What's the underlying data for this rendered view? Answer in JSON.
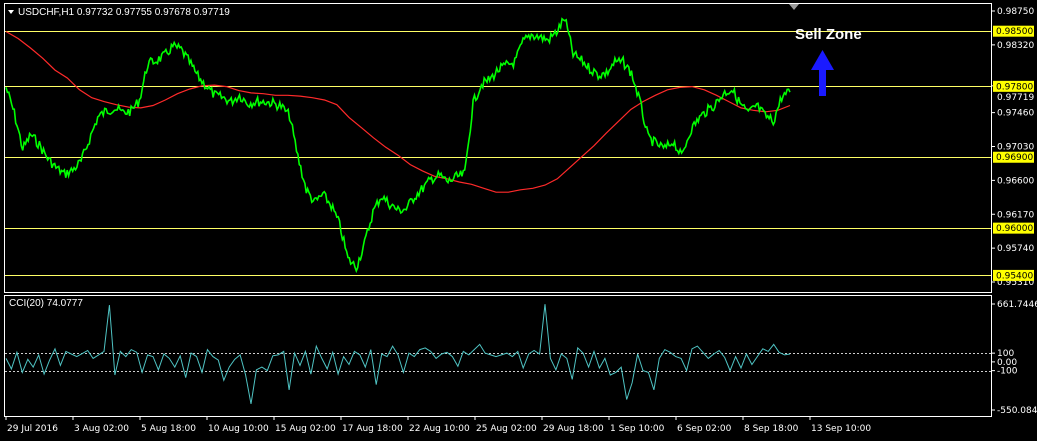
{
  "header": {
    "symbol_text": "USDCHF,H1  0.97732 0.97755 0.97678 0.97719",
    "indicator_text": "CCI(20) 74.0777"
  },
  "annotation": {
    "text": "Sell Zone",
    "arrow_color": "#1a1aff"
  },
  "colors": {
    "background": "#000000",
    "price_line": "#00ff00",
    "moving_average": "#ff2a2a",
    "level_line": "#ffff66",
    "level_label_bg": "#ffff00",
    "cci_line": "#4fc3c3",
    "axis_text": "#ffffff"
  },
  "chart_data": [
    {
      "type": "line",
      "title": "USDCHF,H1",
      "ylim": [
        0.9531,
        0.9875
      ],
      "x_ticks": [
        "29 Jul 2016",
        "3 Aug 02:00",
        "5 Aug 18:00",
        "10 Aug 10:00",
        "15 Aug 02:00",
        "17 Aug 18:00",
        "22 Aug 10:00",
        "25 Aug 02:00",
        "29 Aug 18:00",
        "1 Sep 10:00",
        "6 Sep 02:00",
        "8 Sep 18:00",
        "13 Sep 10:00"
      ],
      "y_ticks": [
        "0.98750",
        "0.98320",
        "0.97800",
        "0.97460",
        "0.97030",
        "0.96600",
        "0.96170",
        "0.95740",
        "0.95310"
      ],
      "level_lines": [
        0.985,
        0.978,
        0.969,
        0.96,
        0.954
      ],
      "level_labels": [
        "0.98500",
        "0.97800",
        "0.96900",
        "0.96000",
        "0.95400"
      ],
      "current_price": 0.97719,
      "current_label": "0.97719",
      "series": [
        {
          "values": [
            0.9778,
            0.9745,
            0.97,
            0.9718,
            0.9705,
            0.9688,
            0.9676,
            0.9668,
            0.9673,
            0.9684,
            0.9712,
            0.974,
            0.9748,
            0.9752,
            0.9746,
            0.9748,
            0.9762,
            0.9808,
            0.9812,
            0.9818,
            0.983,
            0.9826,
            0.981,
            0.9792,
            0.978,
            0.9768,
            0.9765,
            0.976,
            0.9768,
            0.9758,
            0.976,
            0.976,
            0.9758,
            0.9754,
            0.9742,
            0.969,
            0.9648,
            0.9632,
            0.9642,
            0.9628,
            0.9604,
            0.956,
            0.955,
            0.958,
            0.962,
            0.964,
            0.963,
            0.9622,
            0.9624,
            0.964,
            0.965,
            0.9662,
            0.9666,
            0.9658,
            0.9664,
            0.9668,
            0.9758,
            0.9782,
            0.9788,
            0.98,
            0.9806,
            0.981,
            0.9836,
            0.9845,
            0.9842,
            0.9838,
            0.9848,
            0.9866,
            0.982,
            0.9812,
            0.9802,
            0.9794,
            0.9796,
            0.981,
            0.981,
            0.9796,
            0.976,
            0.9714,
            0.9706,
            0.97,
            0.971,
            0.969,
            0.9722,
            0.9738,
            0.9748,
            0.9756,
            0.977,
            0.9776,
            0.9758,
            0.9745,
            0.9755,
            0.9742,
            0.9735,
            0.9766,
            0.9772
          ]
        },
        {
          "values": [
            0.9849,
            0.984,
            0.9828,
            0.9815,
            0.98,
            0.979,
            0.9775,
            0.9765,
            0.976,
            0.9756,
            0.9753,
            0.9752,
            0.9755,
            0.9762,
            0.977,
            0.9776,
            0.978,
            0.9781,
            0.9779,
            0.9774,
            0.9771,
            0.977,
            0.9768,
            0.9768,
            0.9767,
            0.9765,
            0.9762,
            0.9756,
            0.974,
            0.9727,
            0.9714,
            0.9702,
            0.9692,
            0.968,
            0.9672,
            0.9665,
            0.9662,
            0.9658,
            0.9655,
            0.965,
            0.9645,
            0.9645,
            0.9648,
            0.965,
            0.9654,
            0.9662,
            0.9676,
            0.969,
            0.9704,
            0.972,
            0.9735,
            0.975,
            0.976,
            0.9768,
            0.9775,
            0.9778,
            0.9779,
            0.9775,
            0.9768,
            0.976,
            0.9752,
            0.9749,
            0.9747,
            0.9749,
            0.9755
          ]
        }
      ]
    },
    {
      "type": "line",
      "title": "CCI(20) 74.0777",
      "ylim": [
        -550.0849,
        661.7446
      ],
      "y_ticks": [
        "661.7446",
        "100",
        "0.00",
        "-100",
        "-550.0849"
      ],
      "reference_lines": [
        100,
        -100
      ],
      "series": [
        {
          "values": [
            40,
            -80,
            110,
            -120,
            30,
            -60,
            80,
            -140,
            20,
            150,
            -40,
            120,
            90,
            60,
            95,
            130,
            40,
            80,
            120,
            650,
            -150,
            120,
            60,
            140,
            110,
            -120,
            80,
            60,
            -90,
            90,
            40,
            -60,
            70,
            -180,
            100,
            60,
            -120,
            140,
            60,
            20,
            -210,
            -60,
            30,
            80,
            -150,
            -480,
            -90,
            -60,
            -100,
            70,
            80,
            120,
            -320,
            100,
            -40,
            120,
            -140,
            180,
            40,
            -80,
            110,
            -140,
            60,
            -30,
            120,
            80,
            -60,
            140,
            -260,
            90,
            60,
            180,
            80,
            -120,
            100,
            60,
            140,
            160,
            120,
            40,
            90,
            110,
            60,
            -50,
            120,
            80,
            140,
            200,
            100,
            80,
            60,
            80,
            100,
            60,
            120,
            -70,
            90,
            130,
            90,
            660,
            40,
            -90,
            90,
            40,
            -200,
            160,
            100,
            -60,
            120,
            -70,
            40,
            -150,
            -120,
            -60,
            -430,
            -240,
            90,
            -100,
            -120,
            -320,
            40,
            140,
            110,
            60,
            40,
            -100,
            150,
            180,
            110,
            40,
            90,
            130,
            50,
            -100,
            60,
            -70,
            90,
            -30,
            60,
            150,
            120,
            200,
            110,
            80,
            90
          ]
        }
      ]
    }
  ]
}
